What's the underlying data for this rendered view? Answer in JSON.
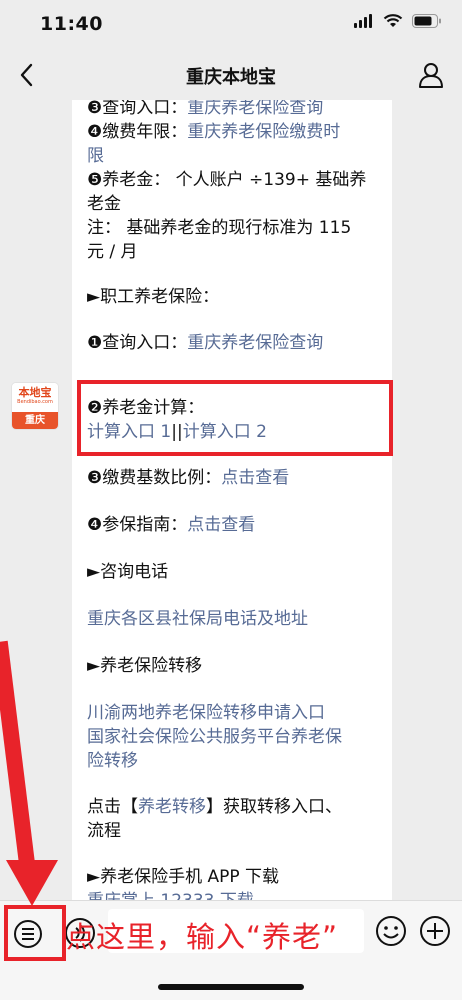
{
  "status_bar": {
    "time": "11:40"
  },
  "nav": {
    "title": "重庆本地宝",
    "back_icon": "chevron-left-icon",
    "profile_icon": "person-icon"
  },
  "message_1": {
    "lines": [
      {
        "prefix": "❸查询入口：",
        "link": "重庆养老保险查询"
      },
      {
        "prefix": "❹缴费年限：",
        "link": "重庆养老保险缴费时"
      },
      {
        "prefix": "",
        "link": "限"
      },
      {
        "prefix": "❺养老金：  个人账户 ÷139+ 基础养",
        "link": ""
      },
      {
        "prefix": "老金",
        "link": ""
      },
      {
        "prefix": "注：  基础养老金的现行标准为 115",
        "link": ""
      },
      {
        "prefix": "元 / 月",
        "link": ""
      },
      {
        "prefix": "►职工养老保险：",
        "link": ""
      },
      {
        "prefix": "❶查询入口：",
        "link": "重庆养老保险查询"
      }
    ]
  },
  "avatar": {
    "brand": "本地宝",
    "url": "Bendibao.com",
    "city": "重庆"
  },
  "message_2": {
    "line1": "❷养老金计算：",
    "calc_link_1": "计算入口 1",
    "separator": "||",
    "calc_link_2": "计算入口 2",
    "base_ratio_prefix": "❸缴费基数比例：",
    "base_ratio_link": "点击查看",
    "guide_prefix": "❹参保指南：",
    "guide_link": "点击查看",
    "hotline_header": "►咨询电话",
    "hotline_link": "重庆各区县社保局电话及地址",
    "transfer_header": "►养老保险转移",
    "transfer_link_1": "川渝两地养老保险转移申请入口",
    "transfer_link_2a": "国家社会保险公共服务平台养老保",
    "transfer_link_2b": "险转移",
    "click_prefix": "点击【",
    "click_link": "养老转移",
    "click_suffix": "】获取转移入口、",
    "click_line2": "流程",
    "app_header": "►养老保险手机 APP 下载",
    "app_link": "重庆掌上 12333 下载"
  },
  "input_bar": {
    "menu_icon": "list-menu-icon",
    "voice_icon": "voice-icon",
    "emoji_icon": "emoji-icon",
    "plus_icon": "plus-icon"
  },
  "annotation": {
    "text": "点这里，输入“养老”"
  },
  "colors": {
    "link": "#576b95",
    "annotation": "#e8232a",
    "background": "#ededed"
  }
}
